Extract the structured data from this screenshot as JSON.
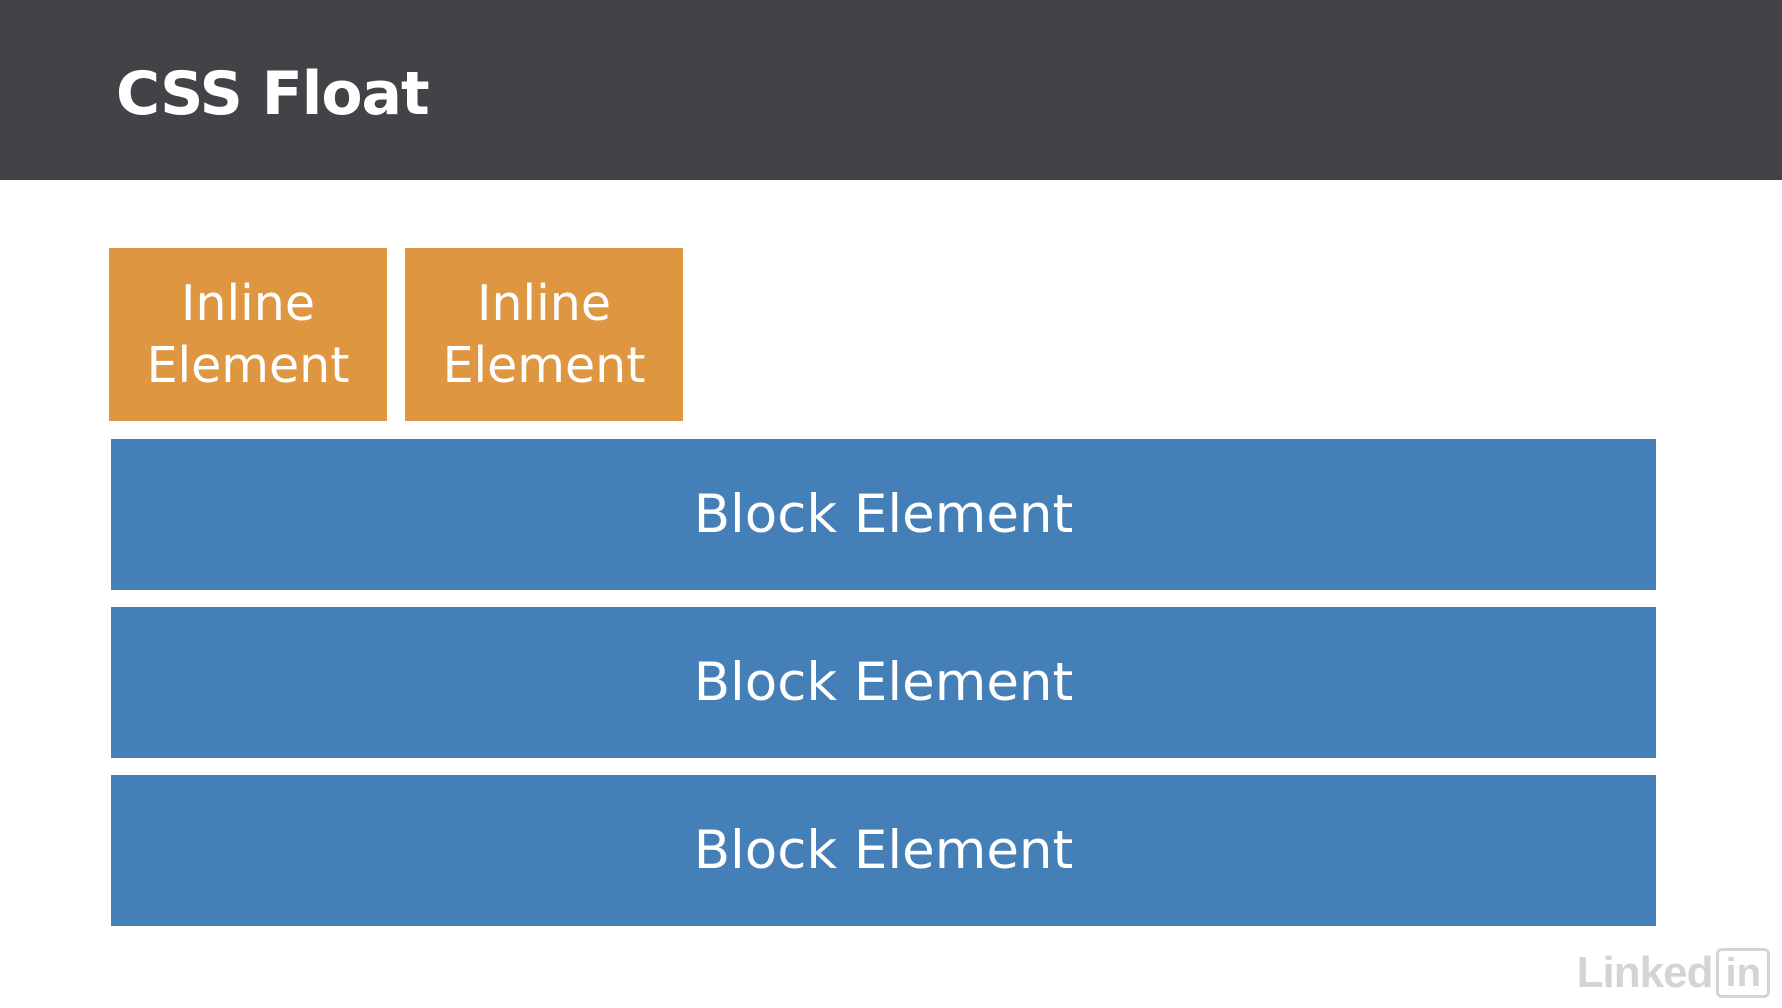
{
  "header": {
    "title": "CSS Float"
  },
  "diagram": {
    "inline_elements": [
      {
        "label": "Inline\nElement"
      },
      {
        "label": "Inline\nElement"
      }
    ],
    "block_elements": [
      {
        "label": "Block Element"
      },
      {
        "label": "Block Element"
      },
      {
        "label": "Block Element"
      }
    ]
  },
  "watermark": {
    "text": "Linked",
    "badge": "in"
  },
  "colors": {
    "header_background": "#424347",
    "inline_element": "#de9640",
    "block_element": "#457fb7",
    "text": "#ffffff"
  }
}
